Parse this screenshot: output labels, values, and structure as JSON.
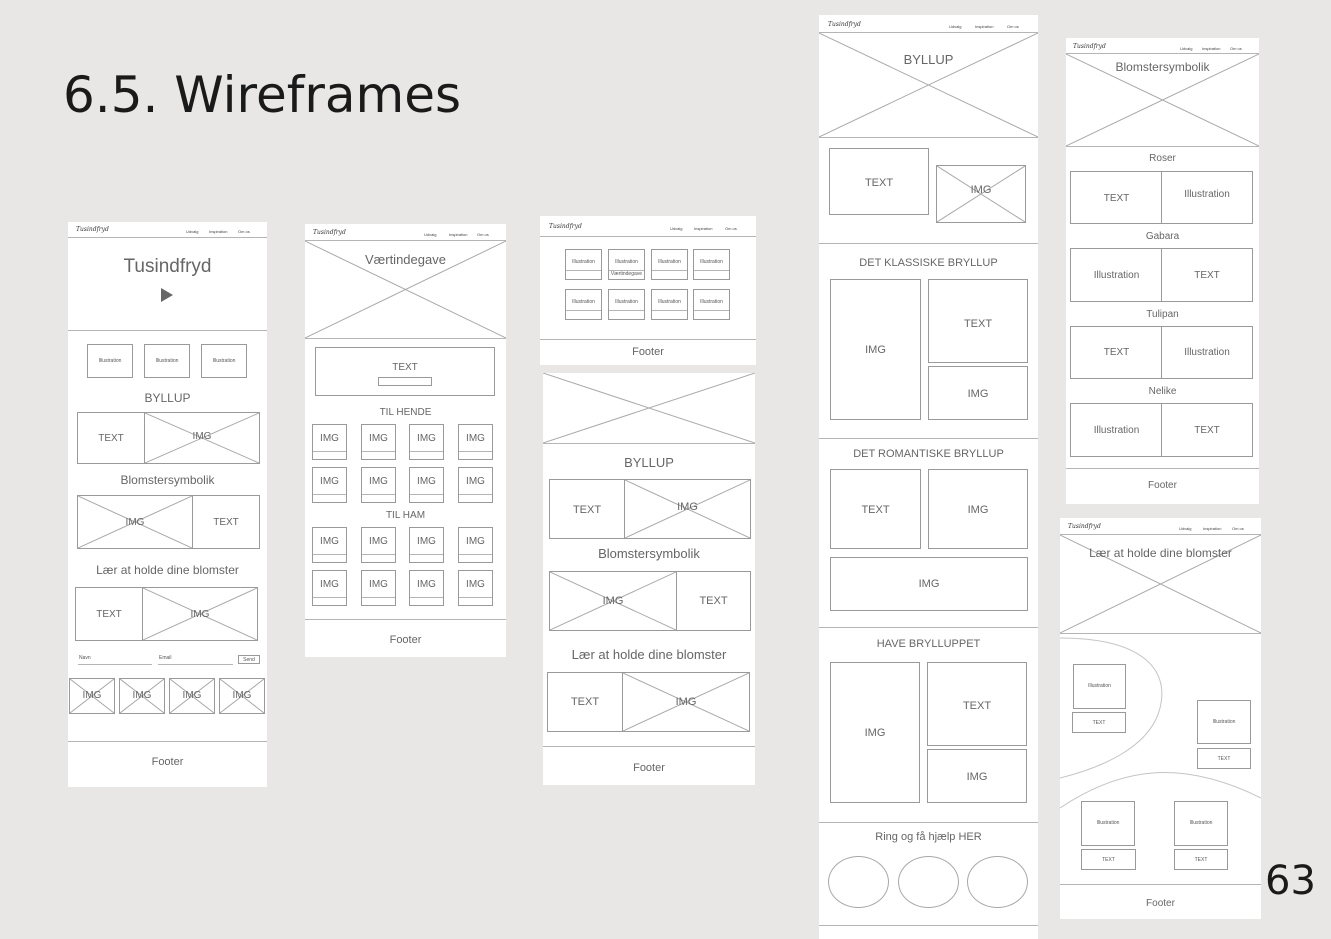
{
  "title": "6.5. Wireframes",
  "page_number": "63",
  "common": {
    "logo": "Tusindfryd",
    "nav": [
      "Udvalg",
      "Inspiration",
      "Om os"
    ],
    "footer": "Footer",
    "img": "IMG",
    "text": "TEXT",
    "illustration": "Illustration"
  },
  "wf1": {
    "hero_title": "Tusindfryd",
    "byllup": "BYLLUP",
    "blomster": "Blomstersymbolik",
    "laer": "Lær at holde dine blomster",
    "form_name": "Navn",
    "form_email": "Email",
    "form_send": "Send"
  },
  "wf2": {
    "hero_title": "Værtindegave",
    "til_hende": "TIL HENDE",
    "til_ham": "TIL HAM"
  },
  "wf3": {
    "sub_label": "Værtindegave",
    "byllup": "BYLLUP",
    "blomster": "Blomstersymbolik",
    "laer": "Lær at holde dine blomster"
  },
  "wf4": {
    "hero_title": "BYLLUP",
    "klassiske": "DET KLASSISKE BRYLLUP",
    "romantiske": "DET ROMANTISKE BRYLLUP",
    "have": "HAVE BRYLLUPPET",
    "ring": "Ring og få hjælp HER"
  },
  "wf5": {
    "hero_title": "Blomstersymbolik",
    "flowers": [
      "Roser",
      "Gabara",
      "Tulipan",
      "Nelike"
    ]
  },
  "wf6": {
    "hero_title": "Lær at holde dine blomster"
  }
}
